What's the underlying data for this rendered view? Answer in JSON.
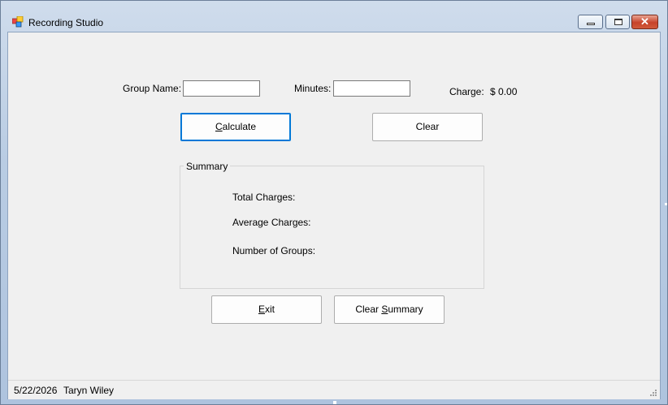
{
  "window": {
    "title": "Recording Studio"
  },
  "form": {
    "group_name_label": "Group Name:",
    "group_name_value": "",
    "minutes_label": "Minutes:",
    "minutes_value": "",
    "charge_label": "Charge:",
    "charge_value": "$ 0.00"
  },
  "buttons": {
    "calculate_prefix": "",
    "calculate_accel": "C",
    "calculate_rest": "alculate",
    "clear": "Clear",
    "exit_prefix": "",
    "exit_accel": "E",
    "exit_rest": "xit",
    "clear_summary_prefix": "Clear ",
    "clear_summary_accel": "S",
    "clear_summary_rest": "ummary"
  },
  "summary": {
    "title": "Summary",
    "total_charges_label": "Total Charges:",
    "average_charges_label": "Average Charges:",
    "number_of_groups_label": "Number of Groups:"
  },
  "status": {
    "date": "5/22/2026",
    "user": "Taryn Wiley"
  },
  "icons": {
    "app": "app-icon",
    "minimize": "minimize-icon",
    "maximize": "maximize-icon",
    "close": "close-icon",
    "grip": "resize-grip-icon"
  },
  "colors": {
    "client_bg": "#f0f0f0",
    "focus_border": "#0078d7",
    "close_button": "#c7432a"
  }
}
